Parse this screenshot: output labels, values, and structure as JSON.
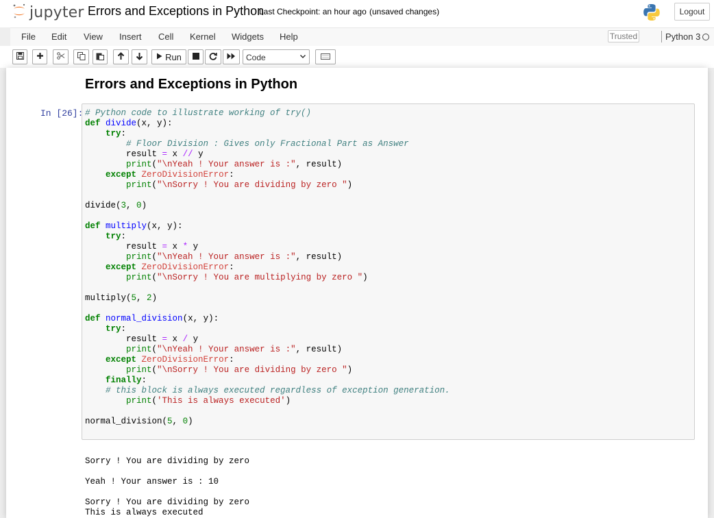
{
  "header": {
    "logo_text": "jupyter",
    "notebook_title": "Errors and Exceptions in Python",
    "checkpoint": "Last Checkpoint: an hour ago",
    "autosave_status": "(unsaved changes)",
    "logout_label": "Logout"
  },
  "menubar": {
    "items": [
      "File",
      "Edit",
      "View",
      "Insert",
      "Cell",
      "Kernel",
      "Widgets",
      "Help"
    ],
    "trusted_label": "Trusted",
    "kernel_name": "Python 3"
  },
  "toolbar": {
    "run_label": "Run",
    "cell_type": "Code",
    "icons": [
      "save-icon",
      "plus-icon",
      "scissors-icon",
      "copy-icon",
      "paste-icon",
      "arrow-up-icon",
      "arrow-down-icon",
      "play-icon",
      "stop-icon",
      "restart-icon",
      "fast-forward-icon",
      "keyboard-icon"
    ]
  },
  "notebook": {
    "markdown_heading": "Errors and Exceptions in Python",
    "cell_prompt": "In [26]:",
    "code_lines": [
      [
        [
          "cm",
          "# Python code to illustrate working of try()"
        ]
      ],
      [
        [
          "kw",
          "def"
        ],
        [
          "",
          " "
        ],
        [
          "fn",
          "divide"
        ],
        [
          "",
          "(x, y):"
        ]
      ],
      [
        [
          "",
          "    "
        ],
        [
          "kw",
          "try"
        ],
        [
          "",
          ":"
        ]
      ],
      [
        [
          "",
          "        "
        ],
        [
          "cm",
          "# Floor Division : Gives only Fractional Part as Answer"
        ]
      ],
      [
        [
          "",
          "        result "
        ],
        [
          "op",
          "="
        ],
        [
          "",
          " x "
        ],
        [
          "op",
          "//"
        ],
        [
          "",
          " y"
        ]
      ],
      [
        [
          "",
          "        "
        ],
        [
          "bi",
          "print"
        ],
        [
          "",
          "("
        ],
        [
          "st",
          "\"\\nYeah ! Your answer is :\""
        ],
        [
          "",
          ", result)"
        ]
      ],
      [
        [
          "",
          "    "
        ],
        [
          "kw",
          "except"
        ],
        [
          "",
          " "
        ],
        [
          "ex",
          "ZeroDivisionError"
        ],
        [
          "",
          ":"
        ]
      ],
      [
        [
          "",
          "        "
        ],
        [
          "bi",
          "print"
        ],
        [
          "",
          "("
        ],
        [
          "st",
          "\"\\nSorry ! You are dividing by zero \""
        ],
        [
          "",
          ")"
        ]
      ],
      [],
      [
        [
          "",
          "divide("
        ],
        [
          "nm",
          "3"
        ],
        [
          "",
          ", "
        ],
        [
          "nm",
          "0"
        ],
        [
          "",
          ")"
        ]
      ],
      [],
      [
        [
          "kw",
          "def"
        ],
        [
          "",
          " "
        ],
        [
          "fn",
          "multiply"
        ],
        [
          "",
          "(x, y):"
        ]
      ],
      [
        [
          "",
          "    "
        ],
        [
          "kw",
          "try"
        ],
        [
          "",
          ":"
        ]
      ],
      [
        [
          "",
          "        result "
        ],
        [
          "op",
          "="
        ],
        [
          "",
          " x "
        ],
        [
          "op",
          "*"
        ],
        [
          "",
          " y"
        ]
      ],
      [
        [
          "",
          "        "
        ],
        [
          "bi",
          "print"
        ],
        [
          "",
          "("
        ],
        [
          "st",
          "\"\\nYeah ! Your answer is :\""
        ],
        [
          "",
          ", result)"
        ]
      ],
      [
        [
          "",
          "    "
        ],
        [
          "kw",
          "except"
        ],
        [
          "",
          " "
        ],
        [
          "ex",
          "ZeroDivisionError"
        ],
        [
          "",
          ":"
        ]
      ],
      [
        [
          "",
          "        "
        ],
        [
          "bi",
          "print"
        ],
        [
          "",
          "("
        ],
        [
          "st",
          "\"\\nSorry ! You are multiplying by zero \""
        ],
        [
          "",
          ")"
        ]
      ],
      [],
      [
        [
          "",
          "multiply("
        ],
        [
          "nm",
          "5"
        ],
        [
          "",
          ", "
        ],
        [
          "nm",
          "2"
        ],
        [
          "",
          ")"
        ]
      ],
      [],
      [
        [
          "kw",
          "def"
        ],
        [
          "",
          " "
        ],
        [
          "fn",
          "normal_division"
        ],
        [
          "",
          "(x, y):"
        ]
      ],
      [
        [
          "",
          "    "
        ],
        [
          "kw",
          "try"
        ],
        [
          "",
          ":"
        ]
      ],
      [
        [
          "",
          "        result "
        ],
        [
          "op",
          "="
        ],
        [
          "",
          " x "
        ],
        [
          "op",
          "/"
        ],
        [
          "",
          " y"
        ]
      ],
      [
        [
          "",
          "        "
        ],
        [
          "bi",
          "print"
        ],
        [
          "",
          "("
        ],
        [
          "st",
          "\"\\nYeah ! Your answer is :\""
        ],
        [
          "",
          ", result)"
        ]
      ],
      [
        [
          "",
          "    "
        ],
        [
          "kw",
          "except"
        ],
        [
          "",
          " "
        ],
        [
          "ex",
          "ZeroDivisionError"
        ],
        [
          "",
          ":"
        ]
      ],
      [
        [
          "",
          "        "
        ],
        [
          "bi",
          "print"
        ],
        [
          "",
          "("
        ],
        [
          "st",
          "\"\\nSorry ! You are dividing by zero \""
        ],
        [
          "",
          ")"
        ]
      ],
      [
        [
          "",
          "    "
        ],
        [
          "kw",
          "finally"
        ],
        [
          "",
          ":"
        ]
      ],
      [
        [
          "",
          "    "
        ],
        [
          "cm",
          "# this block is always executed regardless of exception generation."
        ]
      ],
      [
        [
          "",
          "        "
        ],
        [
          "bi",
          "print"
        ],
        [
          "",
          "("
        ],
        [
          "st",
          "'This is always executed'"
        ],
        [
          "",
          ")"
        ]
      ],
      [],
      [
        [
          "",
          "normal_division("
        ],
        [
          "nm",
          "5"
        ],
        [
          "",
          ", "
        ],
        [
          "nm",
          "0"
        ],
        [
          "",
          ")"
        ]
      ]
    ],
    "output_lines": [
      "Sorry ! You are dividing by zero",
      "",
      "Yeah ! Your answer is : 10",
      "",
      "Sorry ! You are dividing by zero",
      "This is always executed"
    ]
  }
}
